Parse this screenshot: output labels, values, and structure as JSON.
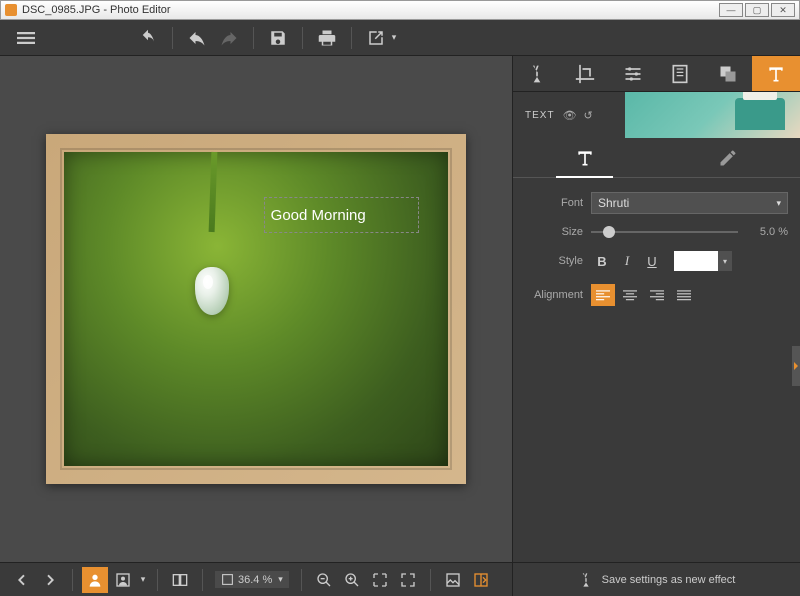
{
  "titlebar": {
    "filename": "DSC_0985.JPG",
    "appname": "Photo Editor"
  },
  "canvas": {
    "overlay_text": "Good Morning"
  },
  "text_panel": {
    "header": "TEXT",
    "font_label": "Font",
    "font_value": "Shruti",
    "size_label": "Size",
    "size_value": "5.0 %",
    "style_label": "Style",
    "align_label": "Alignment"
  },
  "status": {
    "zoom": "36.4 %",
    "save_effect": "Save settings as new effect"
  }
}
